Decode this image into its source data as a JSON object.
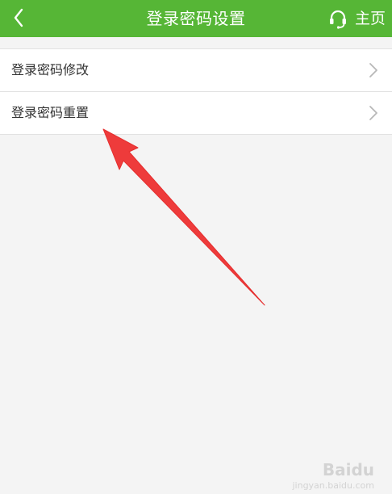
{
  "header": {
    "title": "登录密码设置",
    "back_icon": "chevron-left-icon",
    "home_icon": "headset-icon",
    "home_label": "主页",
    "bg_color": "#56b636"
  },
  "menu": {
    "items": [
      {
        "label": "登录密码修改",
        "icon": "chevron-right-icon"
      },
      {
        "label": "登录密码重置",
        "icon": "chevron-right-icon"
      }
    ]
  },
  "annotation": {
    "arrow_color": "#ee3b3b",
    "points_to": "登录密码重置"
  },
  "watermark": {
    "brand": "Baidu",
    "subtitle": "jingyan.baidu.com"
  }
}
